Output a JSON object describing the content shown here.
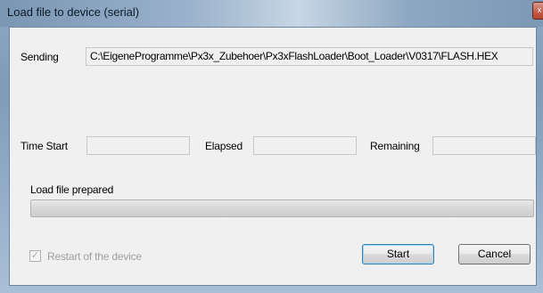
{
  "window": {
    "title": "Load file to device (serial)",
    "close_glyph": "x"
  },
  "sending": {
    "label": "Sending",
    "value": "C:\\EigeneProgramme\\Px3x_Zubehoer\\Px3xFlashLoader\\Boot_Loader\\V0317\\FLASH.HEX"
  },
  "timing": {
    "time_start_label": "Time Start",
    "time_start_value": "",
    "elapsed_label": "Elapsed",
    "elapsed_value": "",
    "remaining_label": "Remaining",
    "remaining_value": ""
  },
  "status": {
    "text": "Load file prepared",
    "progress": 0
  },
  "options": {
    "restart_label": "Restart of the device",
    "restart_checked": true,
    "restart_enabled": false
  },
  "buttons": {
    "start_label": "Start",
    "cancel_label": "Cancel"
  },
  "colors": {
    "titlebar": "#8fa9c4",
    "client_bg": "#f0f0f0",
    "disabled_text": "#a0a0a0",
    "default_button_border": "#3c7fb1"
  }
}
